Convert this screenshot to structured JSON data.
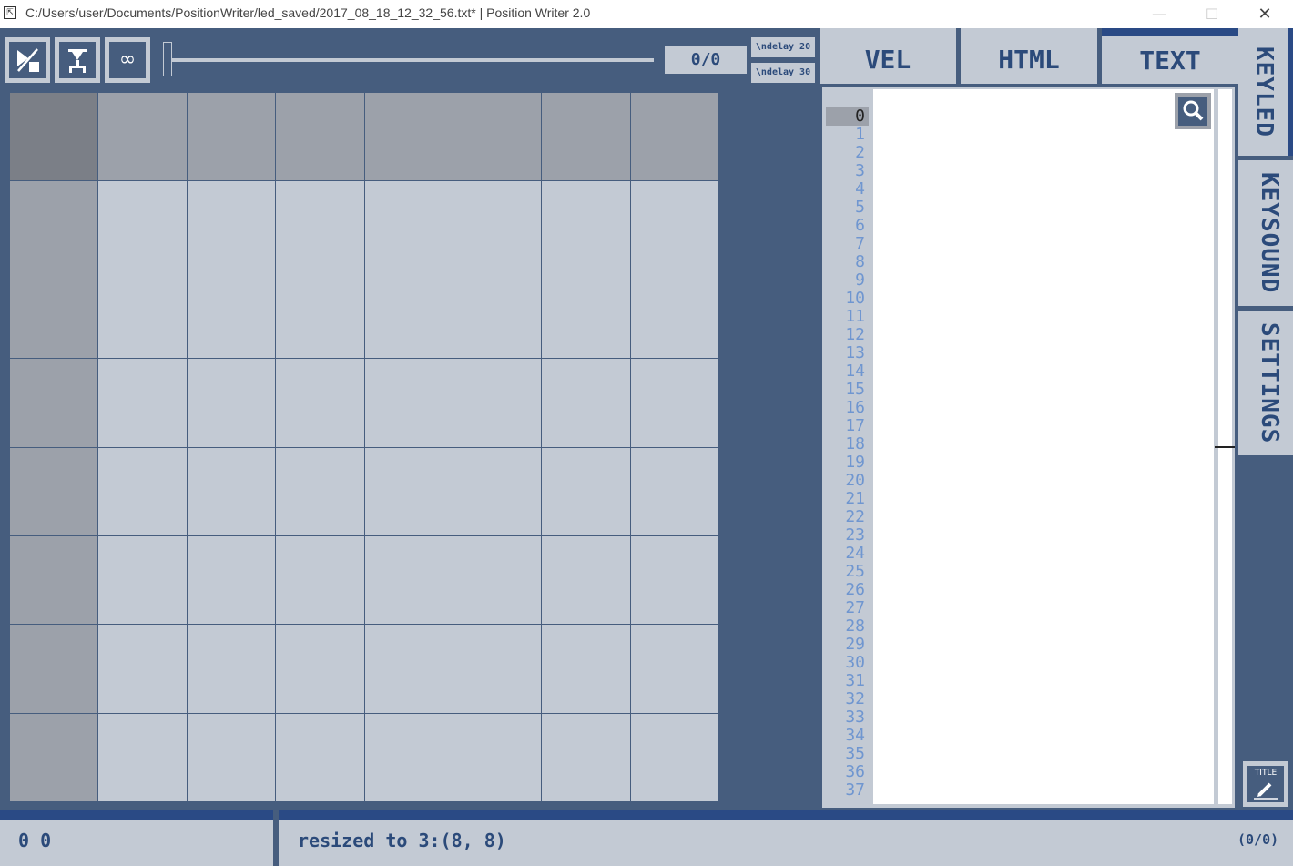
{
  "window": {
    "title": "C:/Users/user/Documents/PositionWriter/led_saved/2017_08_18_12_32_56.txt* | Position Writer 2.0",
    "minimize_glyph": "—",
    "maximize_glyph": "☐",
    "close_glyph": "✕"
  },
  "toolbar": {
    "buttons": [
      {
        "icon": "velocity-toggle-icon"
      },
      {
        "icon": "pin-icon"
      },
      {
        "icon": "loop-icon",
        "glyph": "∞"
      }
    ],
    "frame_counter": "0/0",
    "delay_buttons": [
      "\\ndelay 20",
      "\\ndelay 30"
    ]
  },
  "tabs": {
    "top": [
      "VEL",
      "HTML",
      "TEXT"
    ],
    "active_top": "TEXT",
    "side": [
      "KEYLED",
      "KEYSOUND",
      "SETTINGS"
    ],
    "active_side": "KEYLED"
  },
  "editor": {
    "line_numbers": [
      "0",
      "1",
      "2",
      "3",
      "4",
      "5",
      "6",
      "7",
      "8",
      "9",
      "10",
      "11",
      "12",
      "13",
      "14",
      "15",
      "16",
      "17",
      "18",
      "19",
      "20",
      "21",
      "22",
      "23",
      "24",
      "25",
      "26",
      "27",
      "28",
      "29",
      "30",
      "31",
      "32",
      "33",
      "34",
      "35",
      "36",
      "37"
    ],
    "current_line": "0",
    "search_icon": "search-icon"
  },
  "title_button": {
    "label": "TITLE"
  },
  "status": {
    "position": "0 0",
    "message": "resized to 3:(8, 8)",
    "count": "(0/0)"
  },
  "colors": {
    "background": "#465d7e",
    "panel": "#c3cad4",
    "accent": "#2a4a85",
    "text": "#2b4a7a",
    "line_number": "#6f96d0"
  }
}
